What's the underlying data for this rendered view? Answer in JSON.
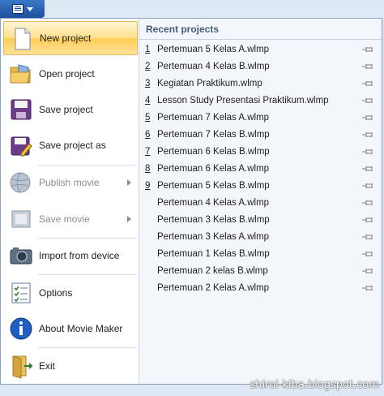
{
  "menu": {
    "items": [
      {
        "label": "New project",
        "icon": "new-document-icon",
        "state": "selected"
      },
      {
        "label": "Open project",
        "icon": "folder-open-icon",
        "state": "normal"
      },
      {
        "label": "Save project",
        "icon": "floppy-disk-icon",
        "state": "normal"
      },
      {
        "label": "Save project as",
        "icon": "save-as-icon",
        "state": "normal"
      },
      {
        "label": "Publish movie",
        "icon": "globe-icon",
        "state": "disabled",
        "submenu": true
      },
      {
        "label": "Save movie",
        "icon": "film-icon",
        "state": "disabled",
        "submenu": true
      },
      {
        "label": "Import from device",
        "icon": "camera-icon",
        "state": "normal"
      },
      {
        "label": "Options",
        "icon": "checklist-icon",
        "state": "normal"
      },
      {
        "label": "About Movie Maker",
        "icon": "info-icon",
        "state": "normal"
      },
      {
        "label": "Exit",
        "icon": "exit-door-icon",
        "state": "normal"
      }
    ]
  },
  "recent": {
    "header": "Recent projects",
    "items": [
      {
        "num": "1",
        "name": "Pertemuan 5 Kelas A.wlmp"
      },
      {
        "num": "2",
        "name": "Pertemuan 4 Kelas B.wlmp"
      },
      {
        "num": "3",
        "name": "Kegiatan Praktikum.wlmp"
      },
      {
        "num": "4",
        "name": "Lesson Study Presentasi Praktikum.wlmp"
      },
      {
        "num": "5",
        "name": "Pertemuan 7 Kelas A.wlmp"
      },
      {
        "num": "6",
        "name": "Pertemuan 7 Kelas B.wlmp"
      },
      {
        "num": "7",
        "name": "Pertemuan 6 Kelas B.wlmp"
      },
      {
        "num": "8",
        "name": "Pertemuan 6 Kelas A.wlmp"
      },
      {
        "num": "9",
        "name": "Pertemuan 5 Kelas B.wlmp"
      },
      {
        "num": "",
        "name": "Pertemuan 4 Kelas A.wlmp"
      },
      {
        "num": "",
        "name": "Pertemuan 3 Kelas B.wlmp"
      },
      {
        "num": "",
        "name": "Pertemuan 3 Kelas A.wlmp"
      },
      {
        "num": "",
        "name": "Pertemuan 1 Kelas B.wlmp"
      },
      {
        "num": "",
        "name": "Pertemuan 2 kelas B.wlmp"
      },
      {
        "num": "",
        "name": "Pertemuan 2 Kelas A.wlmp"
      }
    ]
  },
  "watermark": "shiroi-kiba.blogspot.com",
  "colors": {
    "highlight": "#ffcc55",
    "accent": "#1d4f9e"
  }
}
